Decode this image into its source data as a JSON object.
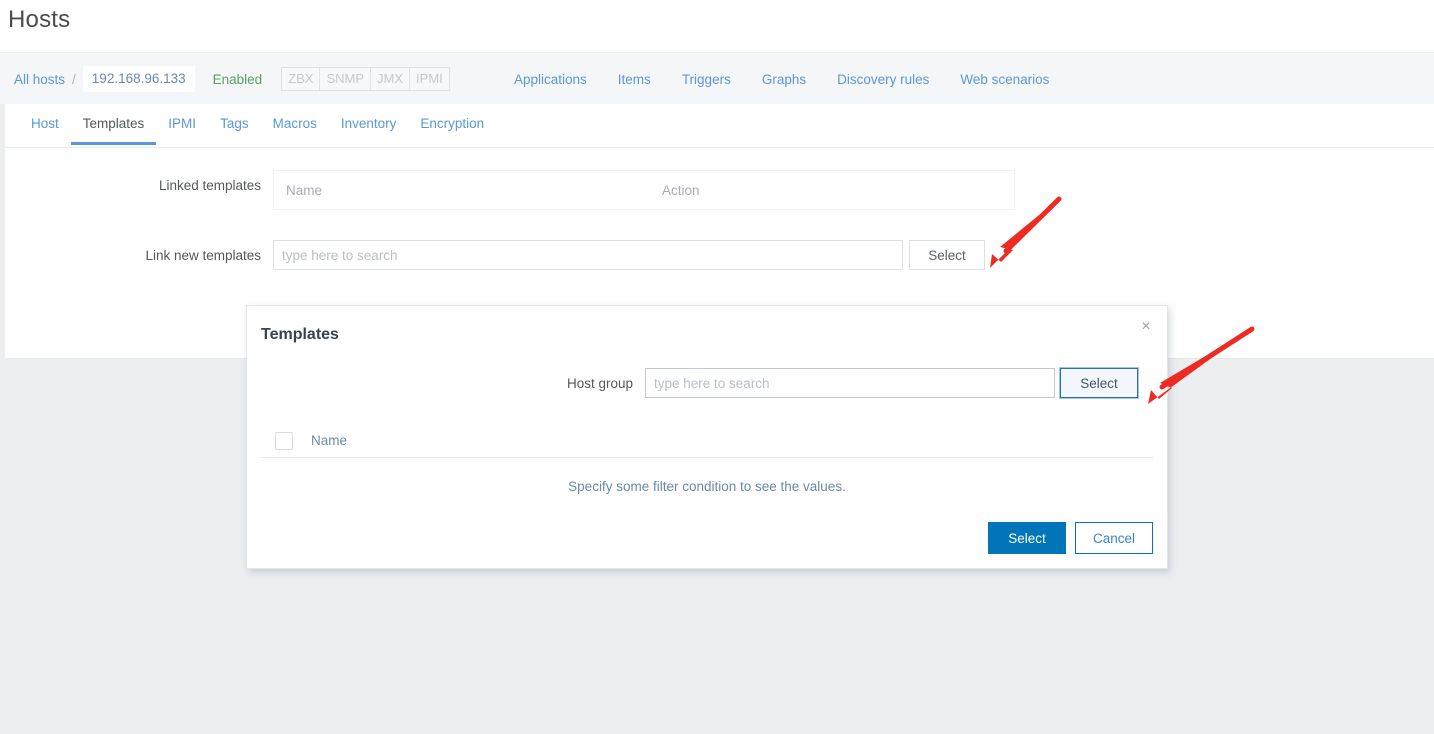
{
  "page": {
    "title": "Hosts"
  },
  "breadcrumb": {
    "all_hosts_label": "All hosts",
    "separator": "/",
    "host_name": "192.168.96.133",
    "status_label": "Enabled",
    "protocol_badges": [
      "ZBX",
      "SNMP",
      "JMX",
      "IPMI"
    ]
  },
  "object_nav": {
    "items": [
      {
        "label": "Applications"
      },
      {
        "label": "Items"
      },
      {
        "label": "Triggers"
      },
      {
        "label": "Graphs"
      },
      {
        "label": "Discovery rules"
      },
      {
        "label": "Web scenarios"
      }
    ]
  },
  "tabs": {
    "items": [
      {
        "label": "Host",
        "active": false
      },
      {
        "label": "Templates",
        "active": true
      },
      {
        "label": "IPMI",
        "active": false
      },
      {
        "label": "Tags",
        "active": false
      },
      {
        "label": "Macros",
        "active": false
      },
      {
        "label": "Inventory",
        "active": false
      },
      {
        "label": "Encryption",
        "active": false
      }
    ]
  },
  "form": {
    "linked_templates": {
      "label": "Linked templates",
      "column_name": "Name",
      "column_action": "Action",
      "rows": []
    },
    "link_new_templates": {
      "label": "Link new templates",
      "input_value": "",
      "input_placeholder": "type here to search",
      "select_button_label": "Select"
    }
  },
  "modal": {
    "title": "Templates",
    "close_label": "×",
    "filter": {
      "label": "Host group",
      "input_value": "",
      "input_placeholder": "type here to search",
      "select_button_label": "Select"
    },
    "table": {
      "column_name": "Name",
      "rows": [],
      "empty_message": "Specify some filter condition to see the values."
    },
    "footer": {
      "select_label": "Select",
      "cancel_label": "Cancel"
    }
  },
  "annotations": {
    "arrow_color": "#ee2b22",
    "arrows": [
      {
        "name": "arrow-to-form-select-button",
        "target": "Select (Link new templates)"
      },
      {
        "name": "arrow-to-modal-select-button",
        "target": "Select (Host group filter)"
      }
    ]
  },
  "colors": {
    "accent_blue": "#0275b8",
    "link_blue": "#5b99d6",
    "status_green": "#5a9e66",
    "page_background": "#eceef0"
  }
}
